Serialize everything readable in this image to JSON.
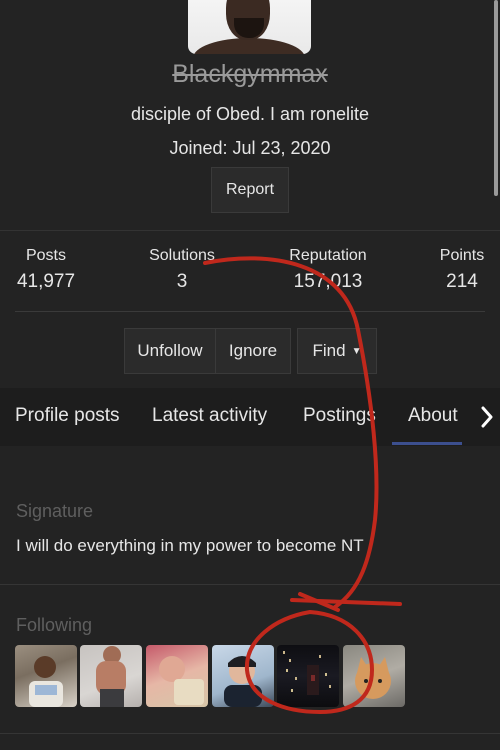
{
  "profile": {
    "username": "Blackgymmax",
    "bio": "disciple of Obed. I am ronelite",
    "joined": "Joined: Jul 23, 2020",
    "report_label": "Report"
  },
  "stats": [
    {
      "label": "Posts",
      "value": "41,977"
    },
    {
      "label": "Solutions",
      "value": "3"
    },
    {
      "label": "Reputation",
      "value": "157,013"
    },
    {
      "label": "Points",
      "value": "214"
    }
  ],
  "actions": {
    "unfollow": "Unfollow",
    "ignore": "Ignore",
    "find": "Find"
  },
  "tabs": [
    {
      "label": "Profile posts"
    },
    {
      "label": "Latest activity"
    },
    {
      "label": "Postings"
    },
    {
      "label": "About",
      "active": true
    }
  ],
  "signature": {
    "heading": "Signature",
    "text": "I will do everything in my power to become NT"
  },
  "following": {
    "heading": "Following"
  },
  "colors": {
    "background": "#232323",
    "tab_active_underline": "#3c4f8e",
    "annotation_stroke": "#c0281c"
  },
  "icons": {
    "tabs_next": "chevron-right-icon",
    "find_dropdown": "caret-down-icon"
  }
}
